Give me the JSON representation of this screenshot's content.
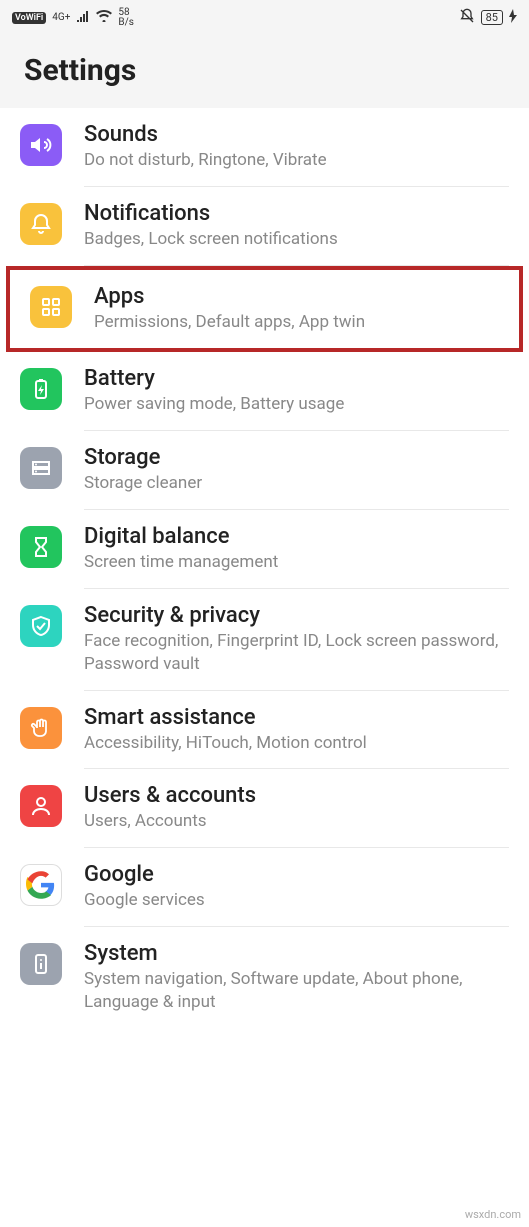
{
  "status_bar": {
    "vowifi": "VoWiFi",
    "network_type": "4G+",
    "speed_value": "58",
    "speed_unit": "B/s",
    "battery": "85"
  },
  "header": {
    "title": "Settings"
  },
  "items": [
    {
      "id": "sounds",
      "title": "Sounds",
      "subtitle": "Do not disturb, Ringtone, Vibrate",
      "color": "#8b5cf6",
      "highlight": false,
      "icon": "sound-icon"
    },
    {
      "id": "notifications",
      "title": "Notifications",
      "subtitle": "Badges, Lock screen notifications",
      "color": "#f9c23c",
      "highlight": false,
      "icon": "bell-icon"
    },
    {
      "id": "apps",
      "title": "Apps",
      "subtitle": "Permissions, Default apps, App twin",
      "color": "#f9c23c",
      "highlight": true,
      "icon": "grid-icon"
    },
    {
      "id": "battery",
      "title": "Battery",
      "subtitle": "Power saving mode, Battery usage",
      "color": "#22c55e",
      "highlight": false,
      "icon": "battery-icon"
    },
    {
      "id": "storage",
      "title": "Storage",
      "subtitle": "Storage cleaner",
      "color": "#9ca3af",
      "highlight": false,
      "icon": "storage-icon"
    },
    {
      "id": "digital-balance",
      "title": "Digital balance",
      "subtitle": "Screen time management",
      "color": "#22c55e",
      "highlight": false,
      "icon": "hourglass-icon"
    },
    {
      "id": "security",
      "title": "Security & privacy",
      "subtitle": "Face recognition, Fingerprint ID, Lock screen password, Password vault",
      "color": "#2dd4bf",
      "highlight": false,
      "icon": "shield-icon"
    },
    {
      "id": "smart-assist",
      "title": "Smart assistance",
      "subtitle": "Accessibility, HiTouch, Motion control",
      "color": "#fb923c",
      "highlight": false,
      "icon": "hand-icon"
    },
    {
      "id": "users",
      "title": "Users & accounts",
      "subtitle": "Users, Accounts",
      "color": "#ef4444",
      "highlight": false,
      "icon": "user-icon"
    },
    {
      "id": "google",
      "title": "Google",
      "subtitle": "Google services",
      "color": "#ffffff",
      "highlight": false,
      "icon": "google-icon"
    },
    {
      "id": "system",
      "title": "System",
      "subtitle": "System navigation, Software update, About phone, Language & input",
      "color": "#9ca3af",
      "highlight": false,
      "icon": "info-icon"
    }
  ],
  "watermark": "wsxdn.com"
}
